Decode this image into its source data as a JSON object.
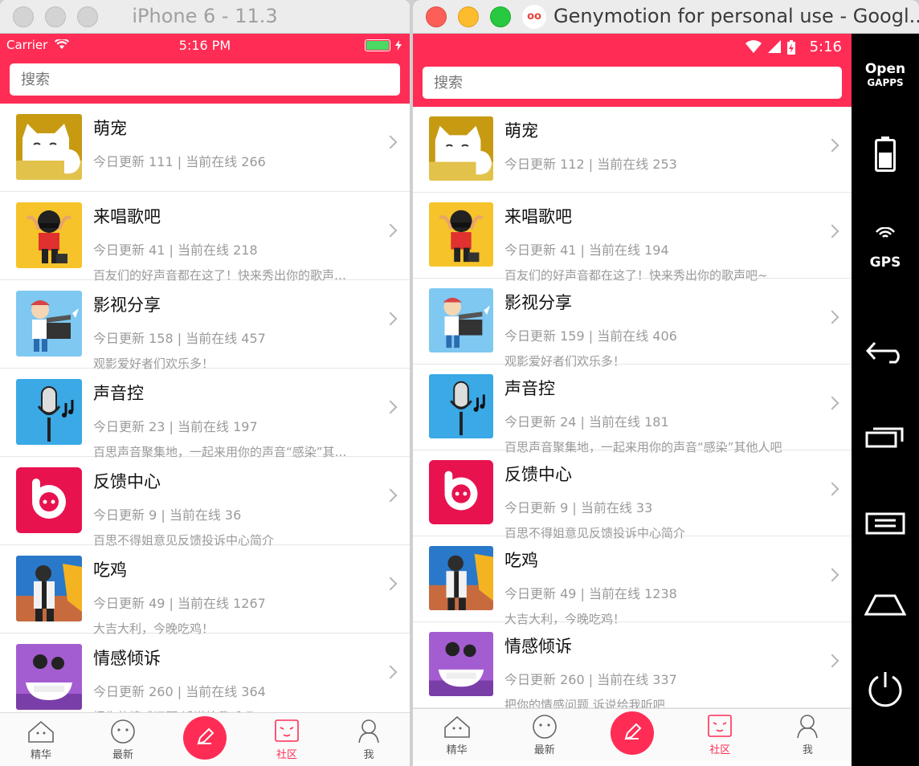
{
  "ios": {
    "window_title": "iPhone 6 - 11.3",
    "status": {
      "carrier": "Carrier",
      "time": "5:16 PM"
    },
    "search_placeholder": "搜索",
    "items": [
      {
        "name": "萌宠",
        "stats": "今日更新 111 | 当前在线 266",
        "desc": ""
      },
      {
        "name": "来唱歌吧",
        "stats": "今日更新 41 | 当前在线 218",
        "desc": "百友们的好声音都在这了！快来秀出你的歌声…"
      },
      {
        "name": "影视分享",
        "stats": "今日更新 158 | 当前在线 457",
        "desc": "观影爱好者们欢乐多！"
      },
      {
        "name": "声音控",
        "stats": "今日更新 23 | 当前在线 197",
        "desc": "百思声音聚集地，一起来用你的声音“感染”其…"
      },
      {
        "name": "反馈中心",
        "stats": "今日更新 9 | 当前在线 36",
        "desc": "百思不得姐意见反馈投诉中心简介"
      },
      {
        "name": "吃鸡",
        "stats": "今日更新 49 | 当前在线 1267",
        "desc": "大吉大利，今晚吃鸡！"
      },
      {
        "name": "情感倾诉",
        "stats": "今日更新 260 | 当前在线 364",
        "desc": "把你的情感问题 诉说给我听吧"
      }
    ]
  },
  "android": {
    "window_title": "Genymotion for personal use - Googl...",
    "logo_text": "oo",
    "status_time": "5:16",
    "search_placeholder": "搜索",
    "items": [
      {
        "name": "萌宠",
        "stats": "今日更新 112 | 当前在线 253",
        "desc": ""
      },
      {
        "name": "来唱歌吧",
        "stats": "今日更新 41 | 当前在线 194",
        "desc": "百友们的好声音都在这了！快来秀出你的歌声吧~"
      },
      {
        "name": "影视分享",
        "stats": "今日更新 159 | 当前在线 406",
        "desc": "观影爱好者们欢乐多！"
      },
      {
        "name": "声音控",
        "stats": "今日更新 24 | 当前在线 181",
        "desc": "百思声音聚集地，一起来用你的声音“感染”其他人吧"
      },
      {
        "name": "反馈中心",
        "stats": "今日更新 9 | 当前在线 33",
        "desc": "百思不得姐意见反馈投诉中心简介"
      },
      {
        "name": "吃鸡",
        "stats": "今日更新 49 | 当前在线 1238",
        "desc": "大吉大利，今晚吃鸡！"
      },
      {
        "name": "情感倾诉",
        "stats": "今日更新 260 | 当前在线 337",
        "desc": "把你的情感问题 诉说给我听吧"
      }
    ],
    "side_panel": {
      "opengapps_1": "Open",
      "opengapps_2": "GAPPS",
      "gps": "GPS"
    }
  },
  "tabs": [
    "精华",
    "最新",
    "社区",
    "我"
  ],
  "active_tab": "社区",
  "thumb_icons": [
    "cat-icon",
    "singer-icon",
    "clapperboard-icon",
    "microphone-icon",
    "feedback-logo-icon",
    "soldier-icon",
    "couple-icon"
  ],
  "colors": {
    "accent": "#ff2d55",
    "text": "#111111",
    "secondary": "#9a9a9a"
  }
}
